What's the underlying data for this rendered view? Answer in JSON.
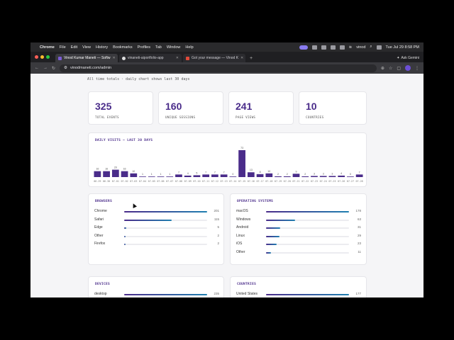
{
  "menubar": {
    "items": [
      "Chrome",
      "File",
      "Edit",
      "View",
      "History",
      "Bookmarks",
      "Profiles",
      "Tab",
      "Window",
      "Help"
    ],
    "user": "vinod",
    "clock": "Tue Jul 29 8:58 PM"
  },
  "tabs": [
    {
      "title": "Vinod Kumar Maneti — Softw"
    },
    {
      "title": "vinaneti-aiportfolio-app"
    },
    {
      "title": "Got your message — Vinod K"
    }
  ],
  "gemini_label": "Ask Gemini",
  "url": "vinodmaneti.com/admin",
  "header_subtitle": "All time totals · daily chart shows last 30 days",
  "stats": [
    {
      "value": "325",
      "label": "TOTAL EVENTS"
    },
    {
      "value": "160",
      "label": "UNIQUE SESSIONS"
    },
    {
      "value": "241",
      "label": "PAGE VIEWS"
    },
    {
      "value": "10",
      "label": "COUNTRIES"
    }
  ],
  "daily": {
    "title": "DAILY VISITS — LAST 30 DAYS",
    "chart_data": {
      "type": "bar",
      "categories": [
        "06-29",
        "06-30",
        "07-01",
        "07-02",
        "07-03",
        "07-04",
        "07-05",
        "07-06",
        "07-07",
        "07-08",
        "07-09",
        "07-10",
        "07-11",
        "07-12",
        "07-13",
        "07-14",
        "07-15",
        "07-16",
        "07-17",
        "07-18",
        "07-19",
        "07-20",
        "07-21",
        "07-22",
        "07-23",
        "07-24",
        "07-25",
        "07-26",
        "07-27",
        "07-28"
      ],
      "values": [
        16,
        16,
        20,
        16,
        10,
        1,
        1,
        1,
        1,
        7,
        4,
        5,
        7,
        7,
        7,
        0,
        73,
        13,
        8,
        10,
        2,
        2,
        9,
        2,
        3,
        3,
        3,
        4,
        0,
        7
      ],
      "color": "#4a2c8a"
    }
  },
  "browsers": {
    "title": "BROWSERS",
    "items": [
      {
        "name": "Chrome",
        "value": "201",
        "pct": 1.0
      },
      {
        "name": "Safari",
        "value": "115",
        "pct": 0.57
      },
      {
        "name": "Edge",
        "value": "5",
        "pct": 0.025
      },
      {
        "name": "Other",
        "value": "2",
        "pct": 0.01
      },
      {
        "name": "Firefox",
        "value": "2",
        "pct": 0.01
      }
    ]
  },
  "os": {
    "title": "OPERATING SYSTEMS",
    "items": [
      {
        "name": "macOS",
        "value": "178",
        "pct": 1.0
      },
      {
        "name": "Windows",
        "value": "63",
        "pct": 0.35
      },
      {
        "name": "Android",
        "value": "31",
        "pct": 0.17
      },
      {
        "name": "Linux",
        "value": "29",
        "pct": 0.16
      },
      {
        "name": "iOS",
        "value": "23",
        "pct": 0.13
      },
      {
        "name": "Other",
        "value": "11",
        "pct": 0.06
      }
    ]
  },
  "devices": {
    "title": "DEVICES",
    "items": [
      {
        "name": "desktop",
        "value": "235",
        "pct": 1.0
      }
    ]
  },
  "countries": {
    "title": "COUNTRIES",
    "items": [
      {
        "name": "United States",
        "value": "177",
        "pct": 1.0
      }
    ]
  }
}
